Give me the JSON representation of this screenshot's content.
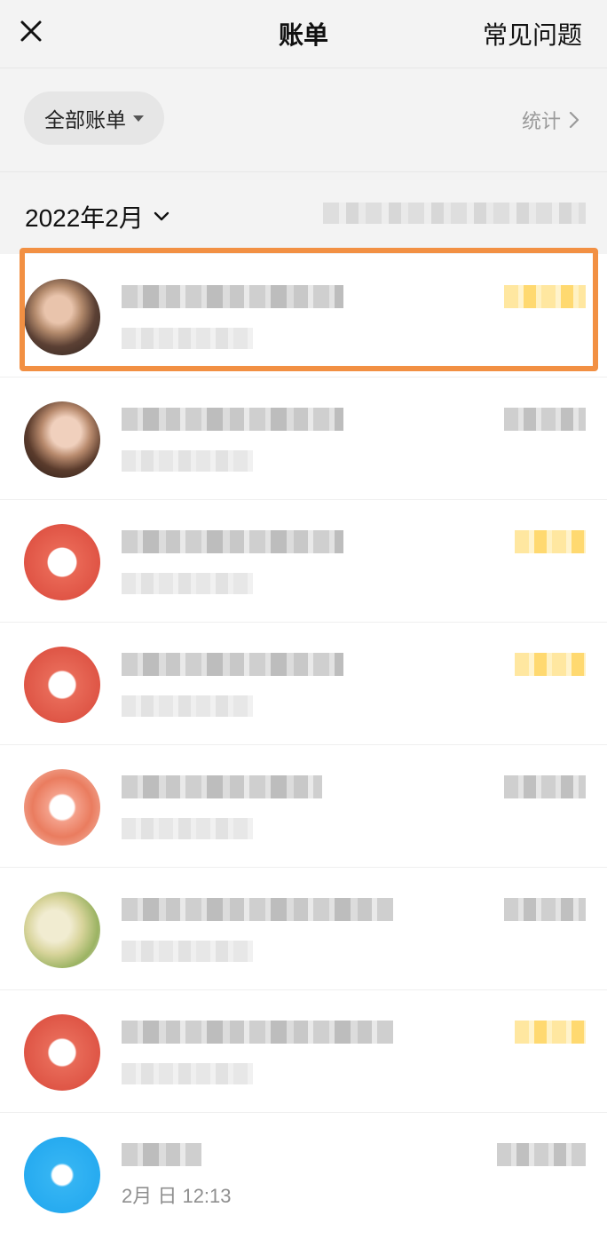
{
  "header": {
    "title": "账单",
    "faq_label": "常见问题"
  },
  "filter": {
    "selected": "全部账单",
    "stats_label": "统计"
  },
  "month": {
    "label": "2022年2月"
  },
  "transactions": [
    {
      "avatar_type": "photo",
      "amount_color": "yellow",
      "visible_subtitle": ""
    },
    {
      "avatar_type": "photo",
      "amount_color": "gray",
      "visible_subtitle": ""
    },
    {
      "avatar_type": "red-logo",
      "amount_color": "yellow",
      "visible_subtitle": ""
    },
    {
      "avatar_type": "red-logo",
      "amount_color": "yellow",
      "visible_subtitle": ""
    },
    {
      "avatar_type": "orange-logo",
      "amount_color": "gray",
      "visible_subtitle": ""
    },
    {
      "avatar_type": "map-photo",
      "amount_color": "gray",
      "visible_subtitle": ""
    },
    {
      "avatar_type": "red-logo",
      "amount_color": "yellow",
      "visible_subtitle": ""
    },
    {
      "avatar_type": "blue-logo",
      "amount_color": "gray",
      "visible_subtitle": "2月  日 12:13"
    }
  ],
  "colors": {
    "highlight_border": "#f29043",
    "header_bg": "#f3f3f3",
    "amount_income_yellow": "#ffd970"
  },
  "icons": {
    "close": "close-icon",
    "filter_dropdown": "caret-down-icon",
    "stats_chevron": "chevron-right-icon",
    "month_dropdown": "chevron-down-icon"
  }
}
